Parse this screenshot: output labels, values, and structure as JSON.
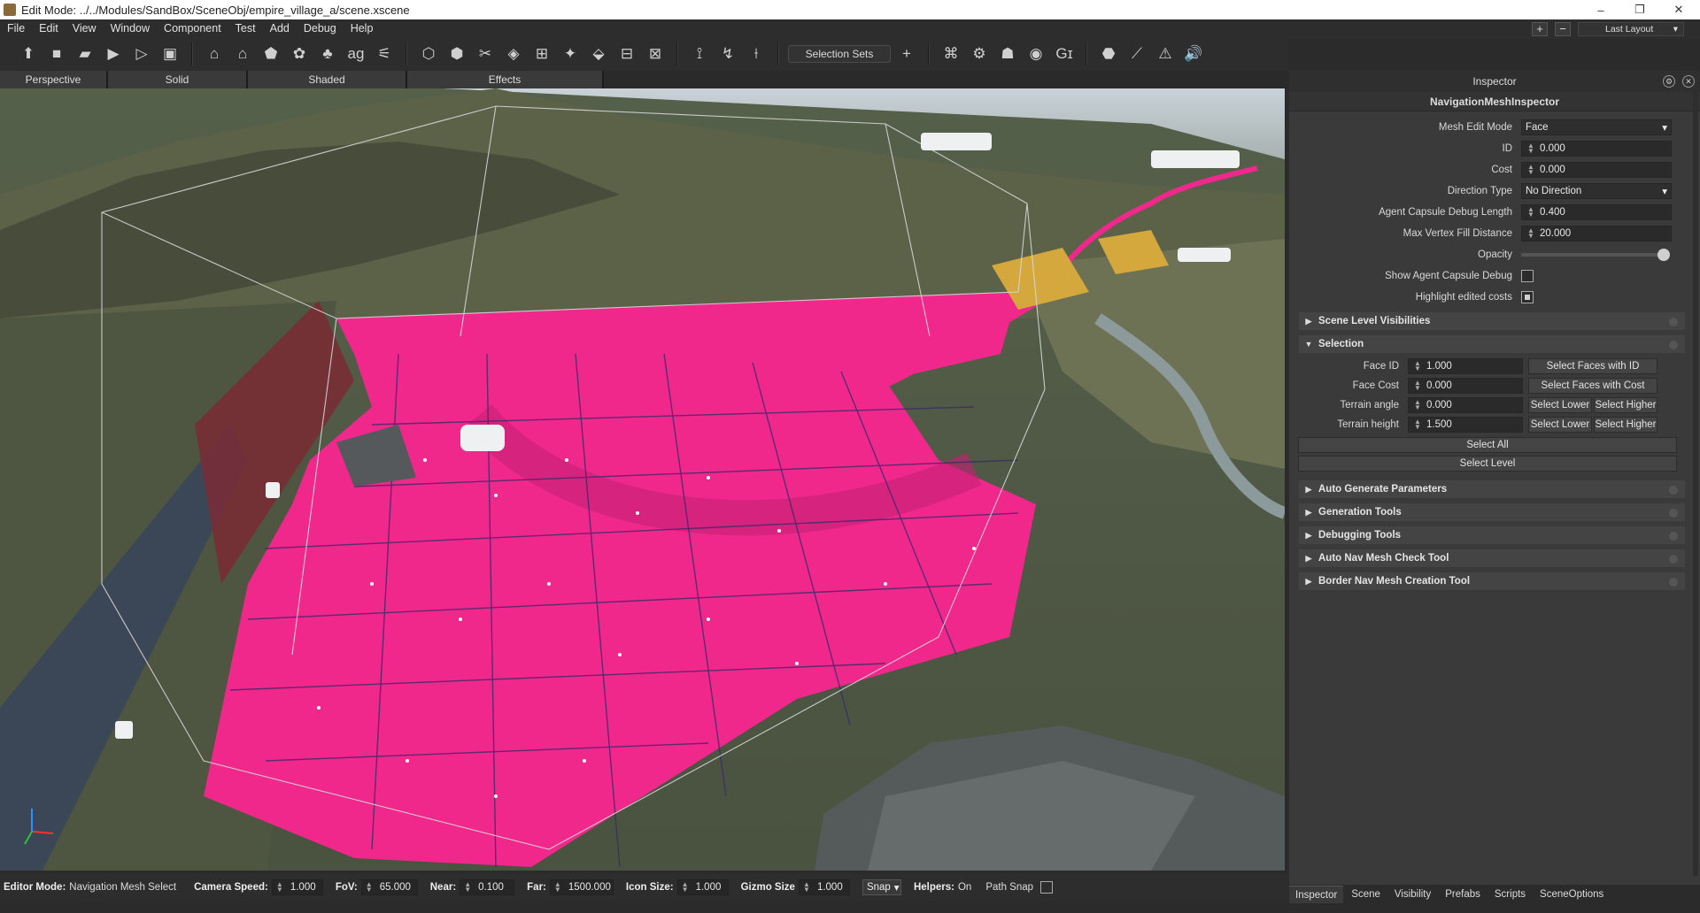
{
  "window": {
    "title": "Edit Mode: ../../Modules/SandBox/SceneObj/empire_village_a/scene.xscene",
    "minimize": "–",
    "restore": "❐",
    "close": "✕"
  },
  "menu": [
    "File",
    "Edit",
    "View",
    "Window",
    "Component",
    "Test",
    "Add",
    "Debug",
    "Help"
  ],
  "layout": {
    "plus": "+",
    "minus": "−",
    "selected": "Last Layout"
  },
  "toolbar": {
    "selection_sets": "Selection Sets",
    "add": "+",
    "icons": [
      "import-icon",
      "save-icon",
      "open-icon",
      "play-icon",
      "play-outline-icon",
      "prefab-icon",
      "house-icon",
      "house2-icon",
      "house3-icon",
      "cluster-icon",
      "tree-icon",
      "text-icon",
      "deform-icon",
      "cube-icon",
      "cube-plus-icon",
      "cut-icon",
      "cube-edit-icon",
      "mesh-icon",
      "particle-icon",
      "cube-bake-icon",
      "path-icon",
      "nav-icon",
      "snap-icon",
      "rotate-icon",
      "measure-icon",
      "camera-icon",
      "settings-icon",
      "tool-icon",
      "sphere-icon",
      "gi-icon",
      "package-icon",
      "ruler-icon",
      "warning-icon",
      "sound-icon"
    ]
  },
  "viewtabs": [
    "Perspective",
    "Solid",
    "Shaded",
    "Effects"
  ],
  "inspector": {
    "title": "Inspector",
    "subtitle": "NavigationMeshInspector",
    "props": {
      "mesh_edit_mode": {
        "label": "Mesh Edit Mode",
        "value": "Face"
      },
      "id": {
        "label": "ID",
        "value": "0.000"
      },
      "cost": {
        "label": "Cost",
        "value": "0.000"
      },
      "direction_type": {
        "label": "Direction Type",
        "value": "No Direction"
      },
      "agent_capsule": {
        "label": "Agent Capsule Debug Length",
        "value": "0.400"
      },
      "max_vertex": {
        "label": "Max Vertex Fill Distance",
        "value": "20.000"
      },
      "opacity": {
        "label": "Opacity",
        "value": 1.0
      },
      "show_agent": {
        "label": "Show Agent Capsule Debug",
        "checked": false
      },
      "highlight_costs": {
        "label": "Highlight edited costs",
        "checked": true
      }
    },
    "sections": {
      "scene_level": "Scene Level Visibilities",
      "selection": "Selection",
      "auto_generate": "Auto Generate Parameters",
      "generation_tools": "Generation Tools",
      "debugging_tools": "Debugging Tools",
      "auto_nav_check": "Auto Nav Mesh Check Tool",
      "border_nav": "Border Nav Mesh Creation Tool"
    },
    "selection": {
      "face_id": {
        "label": "Face ID",
        "value": "1.000",
        "button": "Select Faces with ID"
      },
      "face_cost": {
        "label": "Face Cost",
        "value": "0.000",
        "button": "Select Faces with Cost"
      },
      "terrain_angle": {
        "label": "Terrain angle",
        "value": "0.000",
        "lower": "Select Lower",
        "higher": "Select Higher"
      },
      "terrain_height": {
        "label": "Terrain height",
        "value": "1.500",
        "lower": "Select Lower",
        "higher": "Select Higher"
      },
      "select_all": "Select All",
      "select_level": "Select Level"
    }
  },
  "bottom_tabs": [
    "Inspector",
    "Scene",
    "Visibility",
    "Prefabs",
    "Scripts",
    "SceneOptions"
  ],
  "status": {
    "editor_mode_label": "Editor Mode:",
    "editor_mode_value": "Navigation Mesh Select",
    "camera_speed_label": "Camera Speed:",
    "camera_speed": "1.000",
    "fov_label": "FoV:",
    "fov": "65.000",
    "near_label": "Near:",
    "near": "0.100",
    "far_label": "Far:",
    "far": "1500.000",
    "icon_size_label": "Icon Size:",
    "icon_size": "1.000",
    "gizmo_size_label": "Gizmo Size",
    "gizmo_size": "1.000",
    "snap": "Snap",
    "helpers_label": "Helpers:",
    "helpers_value": "On",
    "path_snap": "Path Snap"
  },
  "colors": {
    "navmesh": "#f0288c",
    "panel": "#3a3a3a",
    "toolbar": "#2d2d2d"
  }
}
